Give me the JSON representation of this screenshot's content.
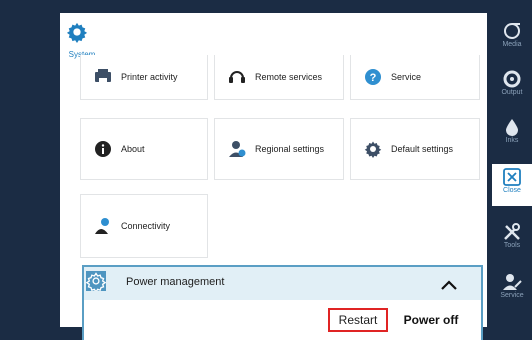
{
  "system": {
    "label": "System"
  },
  "tiles": [
    {
      "label": "Printer activity",
      "icon": "printer-activity-icon"
    },
    {
      "label": "Remote services",
      "icon": "headset-icon"
    },
    {
      "label": "Service",
      "icon": "question-icon"
    },
    {
      "label": "About",
      "icon": "info-icon"
    },
    {
      "label": "Regional settings",
      "icon": "person-globe-icon"
    },
    {
      "label": "Default settings",
      "icon": "gear-icon"
    },
    {
      "label": "Connectivity",
      "icon": "connectivity-icon"
    }
  ],
  "power_management": {
    "title": "Power management",
    "restart_label": "Restart",
    "power_off_label": "Power off"
  },
  "rail": [
    {
      "label": "Media",
      "icon": "media-icon"
    },
    {
      "label": "Output",
      "icon": "output-icon"
    },
    {
      "label": "Inks",
      "icon": "ink-drop-icon"
    },
    {
      "label": "Close",
      "icon": "close-icon"
    },
    {
      "label": "Tools",
      "icon": "tools-icon"
    },
    {
      "label": "Service",
      "icon": "service-icon"
    }
  ],
  "colors": {
    "accent": "#1f7fbf",
    "rail": "#1b2c44",
    "highlight_border": "#e02424",
    "pm_header": "#e1eff6"
  }
}
